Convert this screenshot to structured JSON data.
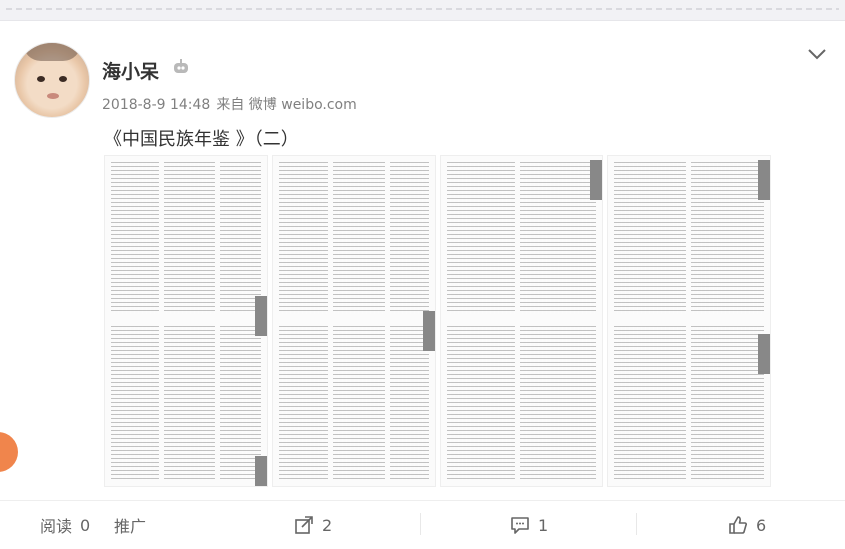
{
  "post": {
    "author": "海小呆",
    "timestamp": "2018-8-9 14:48",
    "source": "来自 微博 weibo.com",
    "text": "《中国民族年鉴 》（二）",
    "image_count": 4
  },
  "actions": {
    "read_label": "阅读",
    "read_count": "0",
    "promote_label": "推广",
    "share_count": "2",
    "comment_count": "1",
    "like_count": "6"
  },
  "icons": {
    "robot": "robot-badge-icon",
    "more": "chevron-down-icon",
    "share": "share-icon",
    "comment": "comment-icon",
    "like": "thumbs-up-icon"
  },
  "colors": {
    "accent_orange": "#f0854c",
    "text_gray": "#808080"
  }
}
